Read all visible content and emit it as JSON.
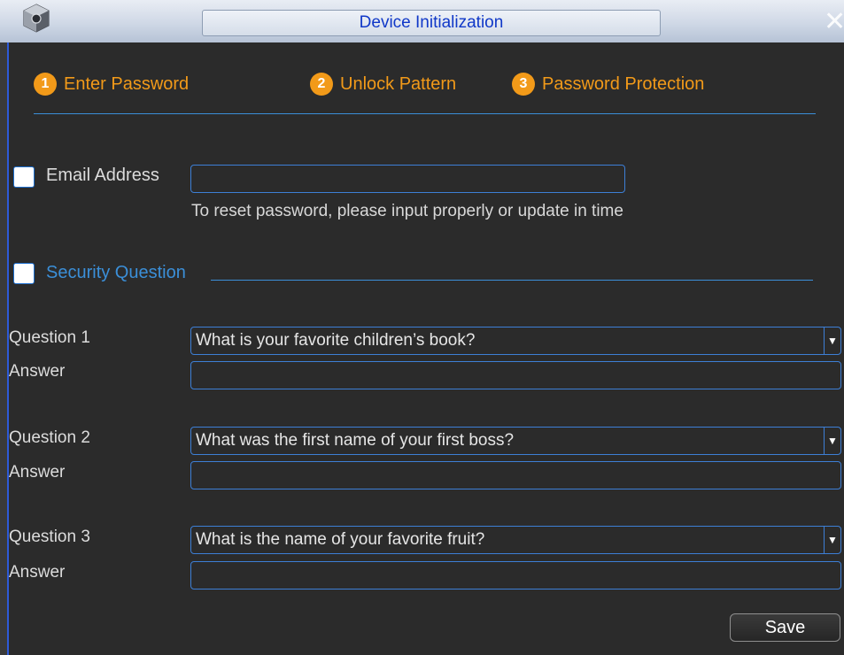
{
  "window": {
    "title": "Device Initialization"
  },
  "steps": [
    {
      "num": "1",
      "label": "Enter Password"
    },
    {
      "num": "2",
      "label": "Unlock Pattern"
    },
    {
      "num": "3",
      "label": "Password Protection"
    }
  ],
  "email": {
    "label": "Email Address",
    "value": "",
    "hint": "To reset password, please input properly or update in time"
  },
  "security": {
    "label": "Security Question",
    "questions": [
      {
        "label": "Question 1",
        "selected": "What is your favorite children’s book?",
        "answer_label": "Answer",
        "answer": ""
      },
      {
        "label": "Question 2",
        "selected": "What was the first name of your first boss?",
        "answer_label": "Answer",
        "answer": ""
      },
      {
        "label": "Question 3",
        "selected": "What is the name of your favorite fruit?",
        "answer_label": "Answer",
        "answer": ""
      }
    ]
  },
  "buttons": {
    "save": "Save"
  },
  "colors": {
    "accent_orange": "#f29a19",
    "accent_blue": "#3b8fd8",
    "title_text": "#1038c8",
    "background": "#2b2b2b"
  }
}
